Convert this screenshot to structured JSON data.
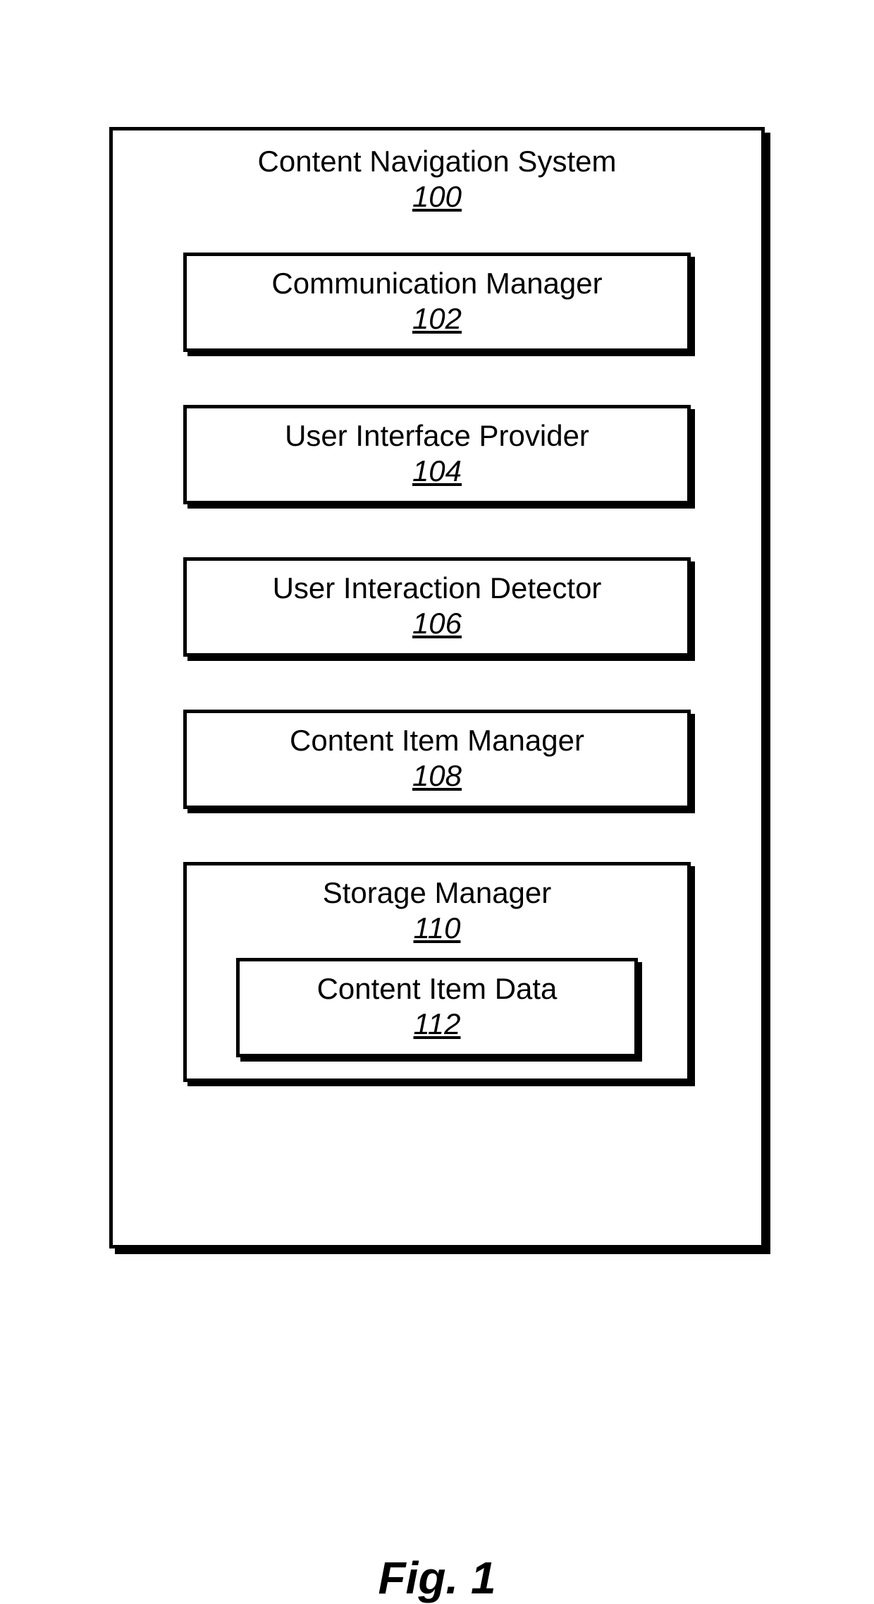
{
  "diagram": {
    "system": {
      "title": "Content Navigation System",
      "ref": "100"
    },
    "components": [
      {
        "title": "Communication Manager",
        "ref": "102"
      },
      {
        "title": "User Interface Provider",
        "ref": "104"
      },
      {
        "title": "User Interaction Detector",
        "ref": "106"
      },
      {
        "title": "Content Item Manager",
        "ref": "108"
      }
    ],
    "storage": {
      "title": "Storage Manager",
      "ref": "110",
      "child": {
        "title": "Content Item Data",
        "ref": "112"
      }
    }
  },
  "figure_label": "Fig. 1"
}
